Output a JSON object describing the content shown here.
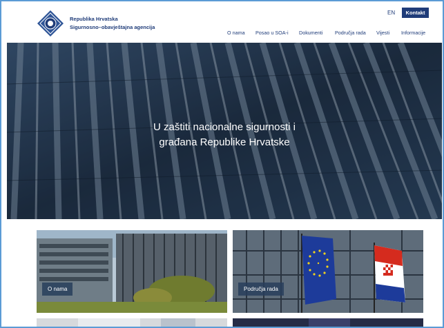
{
  "header": {
    "brand_line1": "Republika Hrvatska",
    "brand_line2": "Sigurnosno–obavještajna agencija",
    "lang_label": "EN",
    "contact_label": "Kontakt"
  },
  "nav": {
    "items": [
      "O nama",
      "Posao u SOA-i",
      "Dokumenti",
      "Područja rada",
      "Vijesti",
      "Informacije"
    ]
  },
  "hero": {
    "title_line1": "U zaštiti nacionalne sigurnosti i",
    "title_line2": "građana Republike Hrvatske"
  },
  "cards": [
    {
      "label": "O nama"
    },
    {
      "label": "Područja rada"
    }
  ],
  "colors": {
    "brand": "#1f3c79",
    "accent_border": "#5b9bd5"
  },
  "icons": {
    "logo": "soa-emblem-icon"
  }
}
